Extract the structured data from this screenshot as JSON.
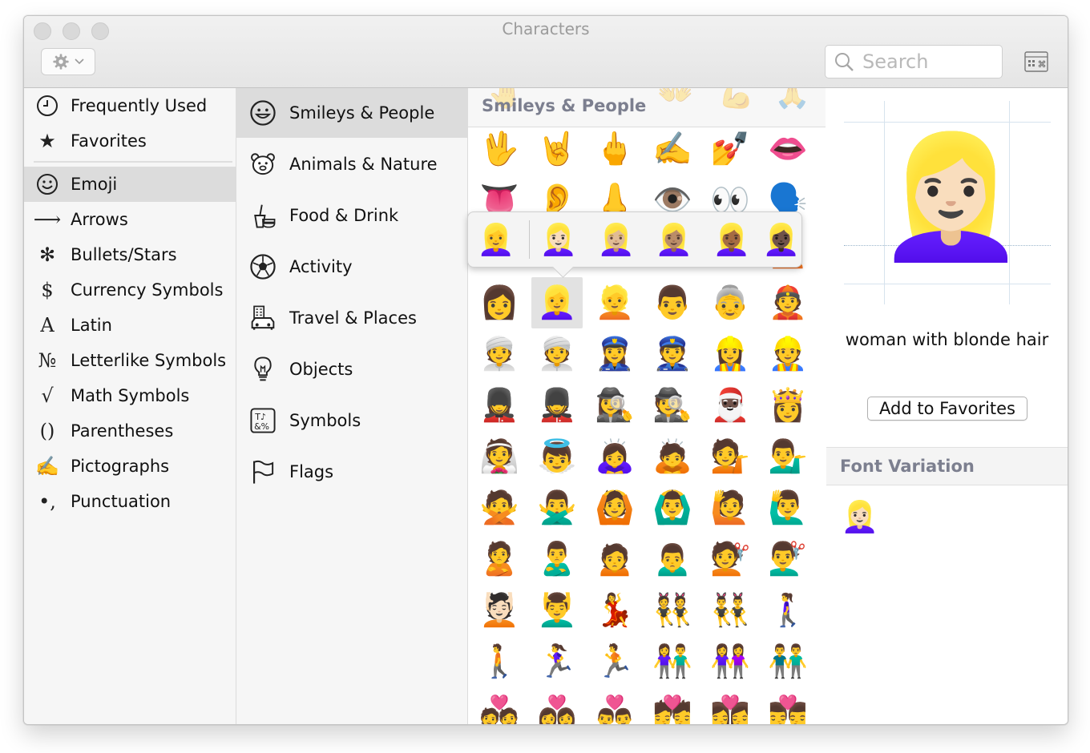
{
  "window": {
    "title": "Characters"
  },
  "search": {
    "placeholder": "Search"
  },
  "sidebar": {
    "items": [
      {
        "label": "Frequently Used",
        "icon": "clock-icon"
      },
      {
        "label": "Favorites",
        "icon": "star-icon"
      },
      {
        "label": "Emoji",
        "icon": "smiley-icon",
        "selected": true
      },
      {
        "label": "Arrows",
        "icon": "arrow-icon"
      },
      {
        "label": "Bullets/Stars",
        "icon": "asterisk-icon"
      },
      {
        "label": "Currency Symbols",
        "icon": "dollar-icon"
      },
      {
        "label": "Latin",
        "icon": "latin-a-icon"
      },
      {
        "label": "Letterlike Symbols",
        "icon": "numero-icon"
      },
      {
        "label": "Math Symbols",
        "icon": "sqrt-icon"
      },
      {
        "label": "Parentheses",
        "icon": "parentheses-icon"
      },
      {
        "label": "Pictographs",
        "icon": "writing-hand-icon"
      },
      {
        "label": "Punctuation",
        "icon": "punctuation-icon"
      }
    ]
  },
  "categories": {
    "items": [
      {
        "label": "Smileys & People",
        "icon": "smiley-icon",
        "selected": true
      },
      {
        "label": "Animals & Nature",
        "icon": "bear-icon"
      },
      {
        "label": "Food & Drink",
        "icon": "food-icon"
      },
      {
        "label": "Activity",
        "icon": "soccer-ball-icon"
      },
      {
        "label": "Travel & Places",
        "icon": "travel-icon"
      },
      {
        "label": "Objects",
        "icon": "lightbulb-icon"
      },
      {
        "label": "Symbols",
        "icon": "symbols-icon"
      },
      {
        "label": "Flags",
        "icon": "flag-icon"
      }
    ]
  },
  "grid": {
    "section_title": "Smileys & People",
    "header_ghosts": [
      "🤚",
      "👐",
      "💪",
      "🙏"
    ],
    "rows": [
      [
        "🖖",
        "🤘",
        "🖕",
        "✍️",
        "💅",
        "👄"
      ],
      [
        "👅",
        "👂",
        "👃",
        "👁️",
        "👀",
        "🗣️"
      ],
      [
        "",
        "",
        "",
        "",
        "",
        "👱"
      ],
      [
        "👩",
        "👱‍♀️",
        "👱",
        "👨",
        "👵",
        "👲"
      ],
      [
        "👳",
        "👳",
        "👮‍♀️",
        "👮",
        "👷‍♀️",
        "👷"
      ],
      [
        "💂‍♀️",
        "💂",
        "🕵️‍♀️",
        "🕵️",
        "🎅🏿",
        "👸"
      ],
      [
        "👰",
        "👼",
        "🙇‍♀️",
        "🙇",
        "💁",
        "💁‍♂️"
      ],
      [
        "🙅",
        "🙅‍♂️",
        "🙆",
        "🙆‍♂️",
        "🙋",
        "🙋‍♂️"
      ],
      [
        "🙎",
        "🙎‍♂️",
        "🙍",
        "🙍‍♂️",
        "💇",
        "💇‍♂️"
      ],
      [
        "💆🏻",
        "💆‍♂️",
        "💃",
        "👯",
        "👯‍♂️",
        "🚶‍♀️"
      ],
      [
        "🚶",
        "🏃‍♀️",
        "🏃",
        "👫",
        "👭",
        "👬"
      ],
      [
        "💑",
        "👩‍❤️‍👩",
        "👨‍❤️‍👨",
        "💏",
        "👩‍❤️‍💋‍👩",
        "👨‍❤️‍💋‍👨"
      ]
    ],
    "selected": {
      "row": 3,
      "col": 1
    },
    "popup_variants": [
      "👱‍♀️",
      "👱🏻‍♀️",
      "👱🏼‍♀️",
      "👱🏽‍♀️",
      "👱🏾‍♀️",
      "👱🏿‍♀️"
    ]
  },
  "detail": {
    "preview_char": "👱🏻‍♀️",
    "name": "woman with blonde hair",
    "add_favorites_label": "Add to Favorites",
    "font_variation_title": "Font Variation",
    "font_variations": [
      "👱🏻‍♀️"
    ]
  }
}
